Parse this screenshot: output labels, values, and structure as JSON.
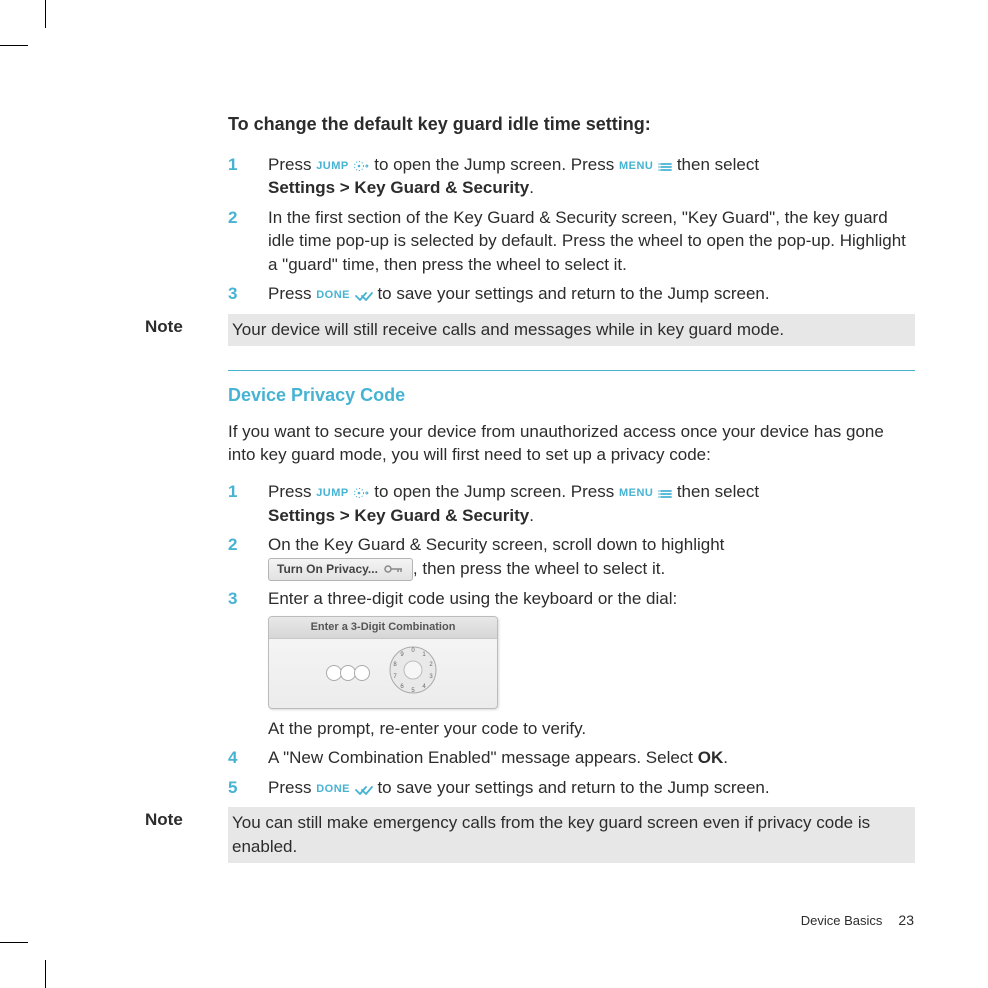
{
  "colors": {
    "accent": "#47b3d3"
  },
  "keycaps": {
    "jump": "JUMP",
    "menu": "MENU",
    "done": "DONE"
  },
  "section1": {
    "heading": "To change the default key guard idle time setting:",
    "steps": [
      {
        "num": "1",
        "pre": "Press ",
        "afterJump": " to open the Jump screen. Press ",
        "afterMenu": " then select ",
        "bold": "Settings > Key Guard & Security",
        "post": "."
      },
      {
        "num": "2",
        "text": "In the first section of the Key Guard & Security screen, \"Key Guard\", the key guard idle time pop-up is selected by default. Press the wheel to open the pop-up. Highlight a \"guard\" time, then press the wheel to select it."
      },
      {
        "num": "3",
        "pre": "Press ",
        "post": " to save your settings and return to the Jump screen."
      }
    ],
    "note": "Your device will still receive calls and messages while in key guard mode."
  },
  "section2": {
    "title": "Device Privacy Code",
    "intro": "If you want to secure your device from unauthorized access once your device has gone into key guard mode, you will first need to set up a privacy code:",
    "steps": [
      {
        "num": "1",
        "pre": "Press ",
        "afterJump": " to open the Jump screen. Press ",
        "afterMenu": " then select ",
        "bold": "Settings > Key Guard & Security",
        "post": "."
      },
      {
        "num": "2",
        "pre": "On the Key Guard & Security screen, scroll down to highlight ",
        "chip": "Turn On Privacy...",
        "post": ", then press the wheel to select it."
      },
      {
        "num": "3",
        "text": "Enter a three-digit code using the keyboard or the dial:",
        "widget_title": "Enter a 3-Digit Combination",
        "dial_digits": [
          "0",
          "1",
          "2",
          "3",
          "4",
          "5",
          "6",
          "7",
          "8",
          "9"
        ],
        "after_widget": "At the prompt, re-enter your code to verify."
      },
      {
        "num": "4",
        "pre": "A \"New Combination Enabled\" message appears. Select ",
        "bold": "OK",
        "post": "."
      },
      {
        "num": "5",
        "pre": "Press ",
        "post": " to save your settings and return to the Jump screen."
      }
    ],
    "note": "You can still make emergency calls from the key guard screen even if privacy code is enabled."
  },
  "labels": {
    "note": "Note"
  },
  "footer": {
    "section": "Device Basics",
    "page": "23"
  }
}
